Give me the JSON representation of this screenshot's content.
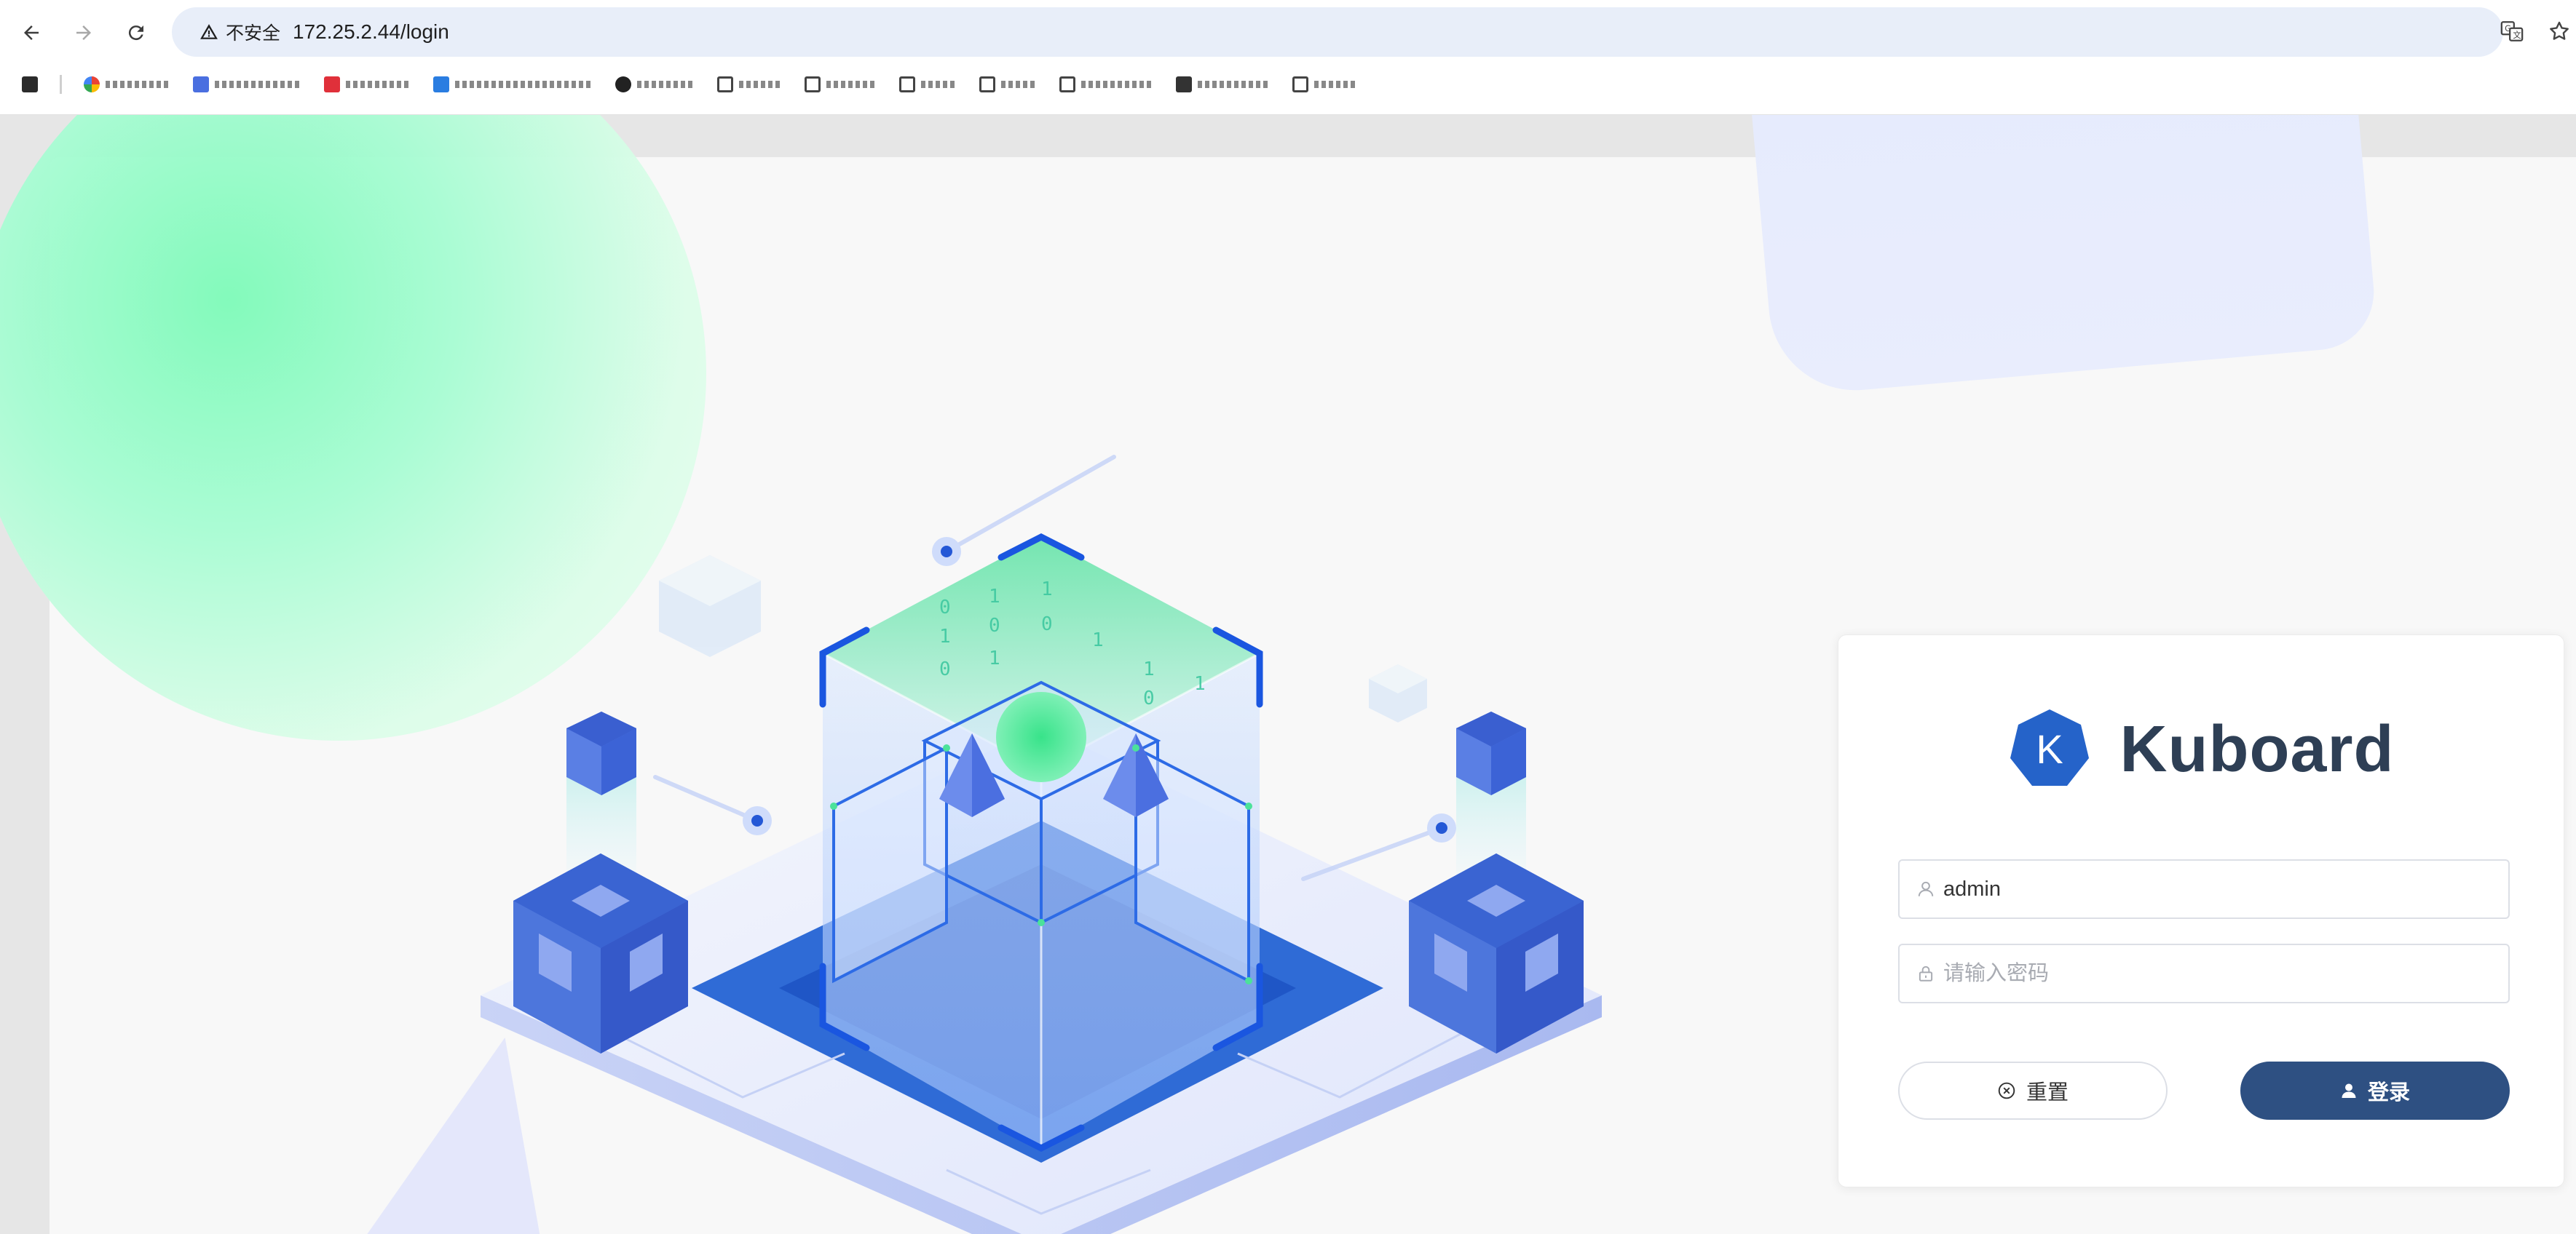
{
  "browser": {
    "security_label": "不安全",
    "url": "172.25.2.44/login",
    "icons": {
      "back": "back-arrow-icon",
      "forward": "forward-arrow-icon",
      "reload": "reload-icon",
      "security": "warning-icon",
      "translate": "translate-icon",
      "bookmark": "star-icon"
    }
  },
  "login": {
    "brand": "Kuboard",
    "logo_letter": "K",
    "username_value": "admin",
    "password_placeholder": "请输入密码",
    "reset_label": "重置",
    "login_label": "登录"
  },
  "colors": {
    "brand_blue": "#2563c9",
    "login_button": "#2e5082",
    "logo_text": "#2e3f55",
    "accent_green": "#7dfab8"
  }
}
